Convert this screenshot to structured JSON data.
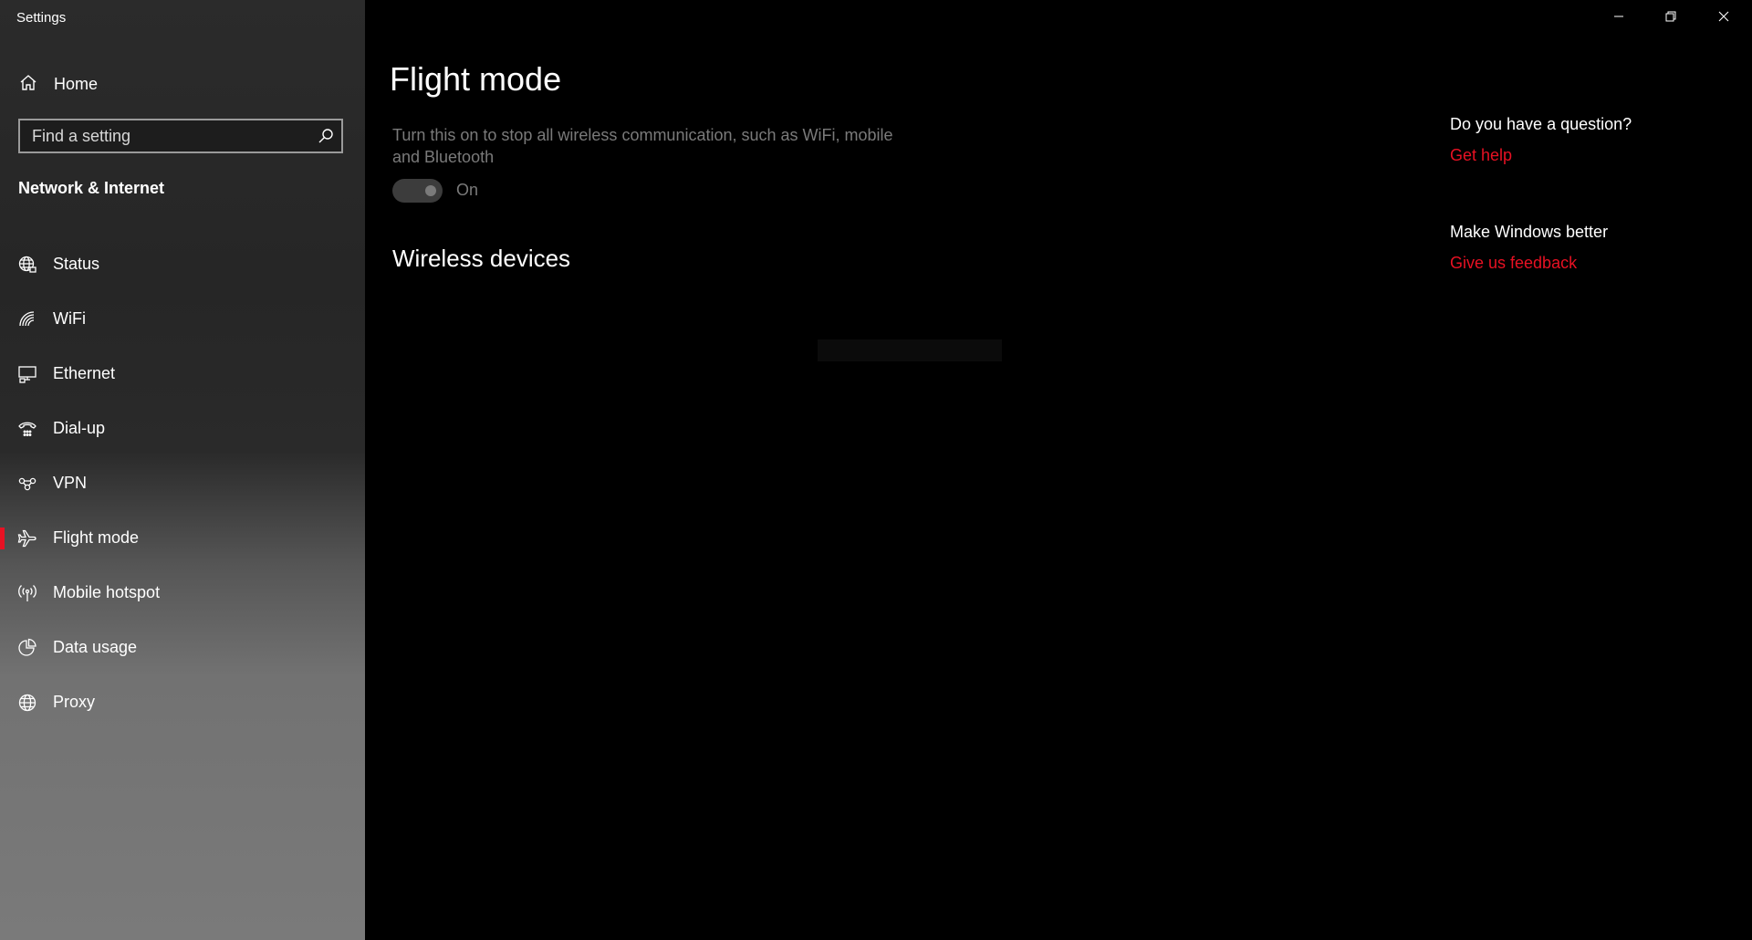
{
  "window": {
    "title": "Settings",
    "controls": {
      "minimize_icon": "minimize-icon",
      "restore_icon": "restore-icon",
      "close_icon": "close-icon"
    }
  },
  "sidebar": {
    "home_label": "Home",
    "search_placeholder": "Find a setting",
    "section_title": "Network & Internet",
    "items": [
      {
        "label": "Status",
        "icon": "globe-status-icon",
        "selected": false
      },
      {
        "label": "WiFi",
        "icon": "wifi-icon",
        "selected": false
      },
      {
        "label": "Ethernet",
        "icon": "ethernet-icon",
        "selected": false
      },
      {
        "label": "Dial-up",
        "icon": "dial-up-icon",
        "selected": false
      },
      {
        "label": "VPN",
        "icon": "vpn-icon",
        "selected": false
      },
      {
        "label": "Flight mode",
        "icon": "airplane-icon",
        "selected": true
      },
      {
        "label": "Mobile hotspot",
        "icon": "hotspot-icon",
        "selected": false
      },
      {
        "label": "Data usage",
        "icon": "pie-chart-icon",
        "selected": false
      },
      {
        "label": "Proxy",
        "icon": "globe-icon",
        "selected": false
      }
    ]
  },
  "main": {
    "title": "Flight mode",
    "description": "Turn this on to stop all wireless communication, such as WiFi, mobile and Bluetooth",
    "toggle": {
      "state_label": "On",
      "on": true
    },
    "wireless_heading": "Wireless devices"
  },
  "help": {
    "question": "Do you have a question?",
    "get_help": "Get help",
    "improve": "Make Windows better",
    "feedback": "Give us feedback"
  },
  "colors": {
    "accent": "#e81123",
    "background": "#000000",
    "disabled_text": "#7a7a7a"
  }
}
